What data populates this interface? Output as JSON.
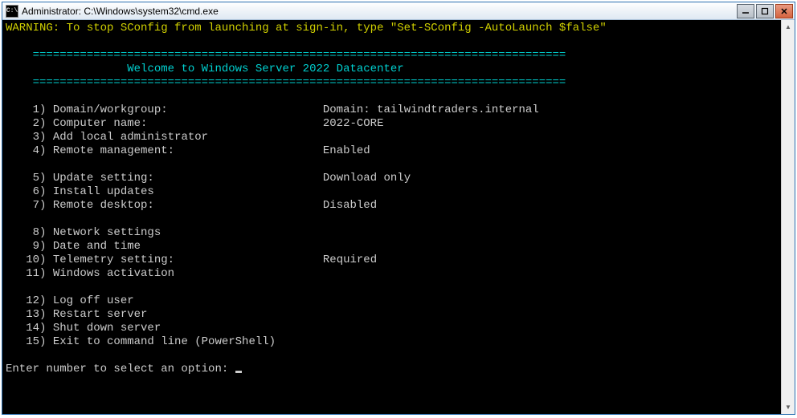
{
  "window": {
    "title": "Administrator: C:\\Windows\\system32\\cmd.exe",
    "icon_label": "cmd-icon"
  },
  "warning": "WARNING: To stop SConfig from launching at sign-in, type \"Set-SConfig -AutoLaunch $false\"",
  "divider": "===============================================================================",
  "banner_indent": "                  ",
  "banner": "Welcome to Windows Server 2022 Datacenter",
  "prompt": "Enter number to select an option: ",
  "menu": [
    {
      "n": "1)",
      "label": "Domain/workgroup:",
      "value": "Domain: tailwindtraders.internal"
    },
    {
      "n": "2)",
      "label": "Computer name:",
      "value": "2022-CORE"
    },
    {
      "n": "3)",
      "label": "Add local administrator",
      "value": ""
    },
    {
      "n": "4)",
      "label": "Remote management:",
      "value": "Enabled"
    },
    {
      "n": "",
      "label": "",
      "value": ""
    },
    {
      "n": "5)",
      "label": "Update setting:",
      "value": "Download only"
    },
    {
      "n": "6)",
      "label": "Install updates",
      "value": ""
    },
    {
      "n": "7)",
      "label": "Remote desktop:",
      "value": "Disabled"
    },
    {
      "n": "",
      "label": "",
      "value": ""
    },
    {
      "n": "8)",
      "label": "Network settings",
      "value": ""
    },
    {
      "n": "9)",
      "label": "Date and time",
      "value": ""
    },
    {
      "n": "10)",
      "label": "Telemetry setting:",
      "value": "Required"
    },
    {
      "n": "11)",
      "label": "Windows activation",
      "value": ""
    },
    {
      "n": "",
      "label": "",
      "value": ""
    },
    {
      "n": "12)",
      "label": "Log off user",
      "value": ""
    },
    {
      "n": "13)",
      "label": "Restart server",
      "value": ""
    },
    {
      "n": "14)",
      "label": "Shut down server",
      "value": ""
    },
    {
      "n": "15)",
      "label": "Exit to command line (PowerShell)",
      "value": ""
    }
  ]
}
